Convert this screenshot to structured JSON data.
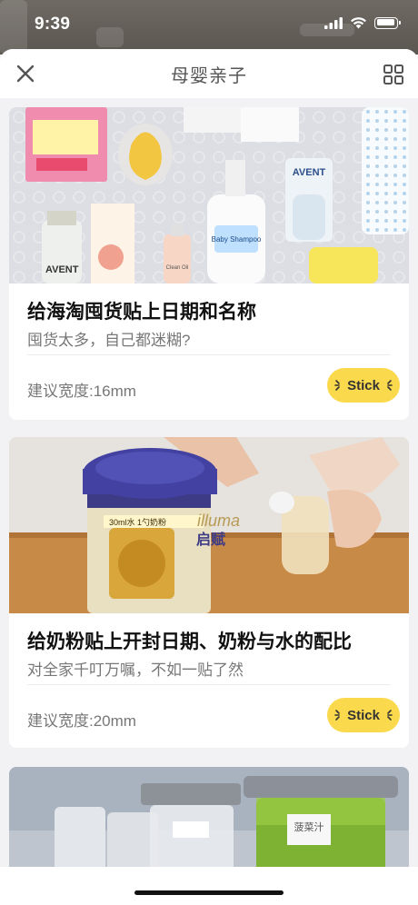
{
  "status_bar": {
    "time": "9:39",
    "icons": [
      "cellular-signal-icon",
      "wifi-icon",
      "battery-icon"
    ]
  },
  "nav": {
    "title": "母婴亲子",
    "left_icon": "close-icon",
    "right_icon": "grid-icon"
  },
  "cards": [
    {
      "image": "baby products labeled on table",
      "title": "给海淘囤货贴上日期和名称",
      "subtitle": "囤货太多，自己都迷糊?",
      "width_text": "建议宽度:16mm",
      "button_label": "Stick"
    },
    {
      "image": "hand scooping milk powder into bottle",
      "title": "给奶粉贴上开封日期、奶粉与水的配比",
      "subtitle": "对全家千叮万嘱，不如一贴了然",
      "width_text": "建议宽度:20mm",
      "button_label": "Stick"
    },
    {
      "image": "labeled food containers",
      "title": "",
      "subtitle": "",
      "width_text": "",
      "button_label": ""
    }
  ],
  "photo_text": {
    "card1_labels": [
      "AVENT",
      "Baby Shampoo",
      "Clean Oil",
      "AVENT"
    ],
    "card2_labels": [
      "illuma",
      "启赋",
      "30ml水 1勺奶粉"
    ],
    "card3_labels": [
      "菠菜汁"
    ]
  },
  "colors": {
    "accent": "#fbd94d",
    "title_text": "#111111",
    "secondary_text": "#777777",
    "nav_title": "#555555",
    "background": "#f2f2f4"
  }
}
